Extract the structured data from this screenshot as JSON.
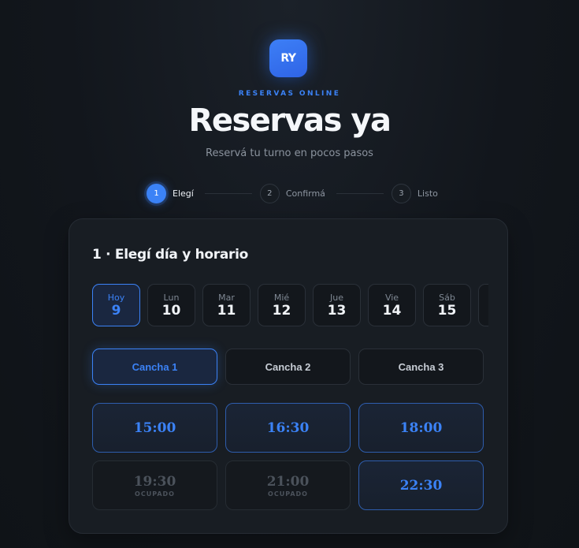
{
  "brand": {
    "logo_text": "RY",
    "eyebrow": "RESERVAS ONLINE",
    "title": "Reservas ya",
    "subtitle": "Reservá tu turno en pocos pasos",
    "accent_color": "#3b82f6"
  },
  "steps": [
    {
      "number": "1",
      "label": "Elegí",
      "active": true
    },
    {
      "number": "2",
      "label": "Confirmá",
      "active": false
    },
    {
      "number": "3",
      "label": "Listo",
      "active": false
    }
  ],
  "card": {
    "title": "1 · Elegí día y horario",
    "days": [
      {
        "name": "Hoy",
        "number": "9",
        "selected": true
      },
      {
        "name": "Lun",
        "number": "10",
        "selected": false
      },
      {
        "name": "Mar",
        "number": "11",
        "selected": false
      },
      {
        "name": "Mié",
        "number": "12",
        "selected": false
      },
      {
        "name": "Jue",
        "number": "13",
        "selected": false
      },
      {
        "name": "Vie",
        "number": "14",
        "selected": false
      },
      {
        "name": "Sáb",
        "number": "15",
        "selected": false
      },
      {
        "name": "",
        "number": "",
        "selected": false
      }
    ],
    "courts": [
      {
        "label": "Cancha 1",
        "selected": true
      },
      {
        "label": "Cancha 2",
        "selected": false
      },
      {
        "label": "Cancha 3",
        "selected": false
      }
    ],
    "slots": [
      {
        "time": "15:00",
        "status": "free",
        "status_label": ""
      },
      {
        "time": "16:30",
        "status": "free",
        "status_label": ""
      },
      {
        "time": "18:00",
        "status": "free",
        "status_label": ""
      },
      {
        "time": "19:30",
        "status": "busy",
        "status_label": "OCUPADO"
      },
      {
        "time": "21:00",
        "status": "busy",
        "status_label": "OCUPADO"
      },
      {
        "time": "22:30",
        "status": "free",
        "status_label": ""
      }
    ]
  }
}
